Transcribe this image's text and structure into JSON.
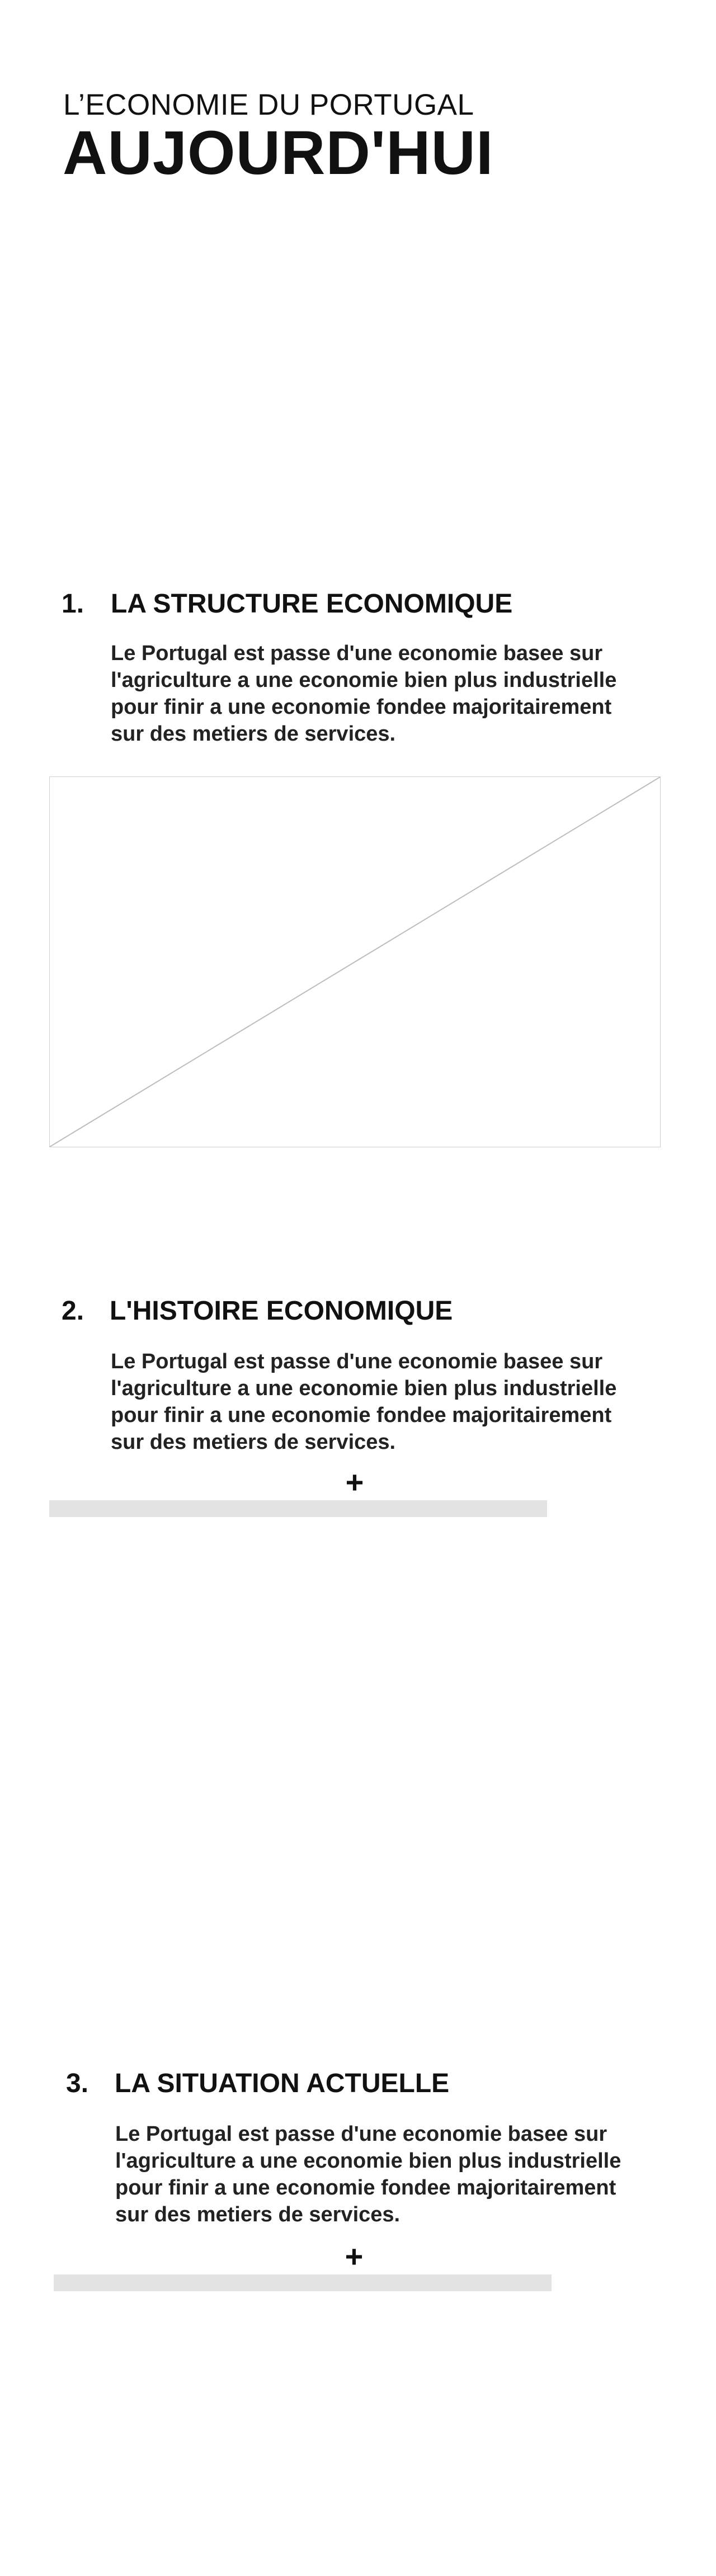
{
  "header": {
    "kicker": "L’ECONOMIE DU PORTUGAL",
    "headline": "AUJOURD'HUI"
  },
  "sections": [
    {
      "number": "1.",
      "title": "LA STRUCTURE ECONOMIQUE",
      "body": "Le Portugal est passe d'une economie basee sur l'agriculture a une economie bien plus industrielle pour finir a une economie fondee majoritairement sur des metiers de services."
    },
    {
      "number": "2.",
      "title": "L'HISTOIRE ECONOMIQUE",
      "body": "Le Portugal est passe d'une economie basee sur l'agriculture a une economie bien plus industrielle pour finir a une economie fondee majoritairement sur des metiers de services.",
      "expand": "+"
    },
    {
      "number": "3.",
      "title": "LA SITUATION ACTUELLE",
      "body": "Le Portugal est passe d'une economie basee sur l'agriculture a une economie bien plus industrielle pour finir a une economie fondee majoritairement sur des metiers de services.",
      "expand": "+"
    }
  ]
}
